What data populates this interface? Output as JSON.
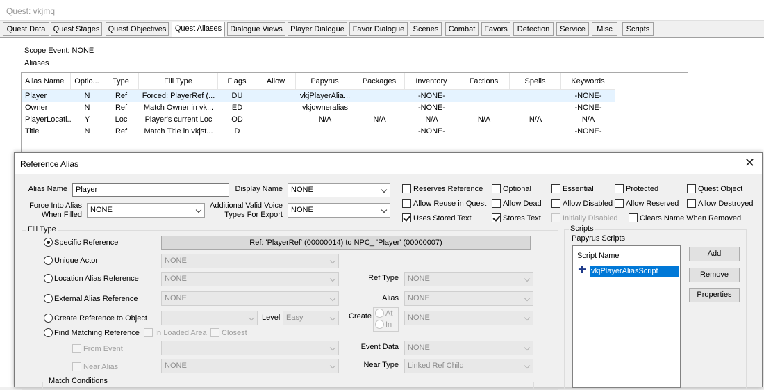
{
  "window": {
    "title": "Quest: vkjmq"
  },
  "tabs": [
    "Quest Data",
    "Quest Stages",
    "Quest Objectives",
    "Quest Aliases",
    "Dialogue Views",
    "Player Dialogue",
    "Favor Dialogue",
    "Scenes",
    "Combat",
    "Favors",
    "Detection",
    "Service",
    "Misc",
    "Scripts"
  ],
  "active_tab": "Quest Aliases",
  "aliases_panel": {
    "scope_event": "Scope Event: NONE",
    "aliases_label": "Aliases",
    "columns": [
      "Alias Name",
      "Optio...",
      "Type",
      "Fill Type",
      "Flags",
      "Allow",
      "Papyrus",
      "Packages",
      "Inventory",
      "Factions",
      "Spells",
      "Keywords"
    ],
    "rows": [
      [
        "Player",
        "N",
        "Ref",
        "Forced: PlayerRef (...",
        "DU",
        "",
        "vkjPlayerAlia...",
        "",
        "-NONE-",
        "",
        "",
        "-NONE-"
      ],
      [
        "Owner",
        "N",
        "Ref",
        "Match Owner in vk...",
        "ED",
        "",
        "vkjowneralias",
        "",
        "-NONE-",
        "",
        "",
        "-NONE-"
      ],
      [
        "PlayerLocati...",
        "Y",
        "Loc",
        "Player's current Loc",
        "OD",
        "",
        "N/A",
        "N/A",
        "N/A",
        "N/A",
        "N/A",
        "N/A"
      ],
      [
        "Title",
        "N",
        "Ref",
        "Match Title in vkjst...",
        "D",
        "",
        "",
        "",
        "-NONE-",
        "",
        "",
        "-NONE-"
      ]
    ]
  },
  "dialog": {
    "title": "Reference Alias",
    "alias_name_label": "Alias Name",
    "alias_name_value": "Player",
    "display_name_label": "Display Name",
    "display_name_value": "NONE",
    "force_into_alias_label_1": "Force Into Alias",
    "force_into_alias_label_2": "When Filled",
    "force_into_alias_value": "NONE",
    "additional_voice_label_1": "Additional Valid Voice",
    "additional_voice_label_2": "Types For Export",
    "additional_voice_value": "NONE",
    "checkboxes": {
      "reserves_reference": "Reserves Reference",
      "optional": "Optional",
      "essential": "Essential",
      "protected": "Protected",
      "quest_object": "Quest Object",
      "allow_reuse": "Allow Reuse in Quest",
      "allow_dead": "Allow Dead",
      "allow_disabled": "Allow Disabled",
      "allow_reserved": "Allow Reserved",
      "allow_destroyed": "Allow Destroyed",
      "uses_stored_text": "Uses Stored Text",
      "stores_text": "Stores Text",
      "initially_disabled": "Initially Disabled",
      "clears_name": "Clears Name When Removed"
    },
    "fill_type": {
      "group_label": "Fill Type",
      "specific_reference": "Specific Reference",
      "specific_reference_value": "Ref: 'PlayerRef' (00000014) to NPC_ 'Player' (00000007)",
      "unique_actor": "Unique Actor",
      "unique_actor_value": "NONE",
      "location_alias_reference": "Location Alias Reference",
      "location_alias_value": "NONE",
      "ref_type_label": "Ref Type",
      "ref_type_value": "NONE",
      "external_alias_reference": "External Alias Reference",
      "external_alias_value": "NONE",
      "alias_label": "Alias",
      "alias_value": "NONE",
      "create_reference": "Create Reference to Object",
      "level_label": "Level",
      "level_value": "Easy",
      "create_label": "Create",
      "create_at": "At",
      "create_in": "In",
      "create_value": "NONE",
      "find_matching_reference": "Find Matching Reference",
      "in_loaded_area": "In Loaded Area",
      "closest": "Closest",
      "from_event": "From Event",
      "event_data_label": "Event Data",
      "event_data_value": "NONE",
      "near_alias": "Near Alias",
      "near_alias_value": "NONE",
      "near_type_label": "Near Type",
      "near_type_value": "Linked Ref Child",
      "match_conditions": "Match Conditions"
    },
    "scripts": {
      "group_label": "Scripts",
      "papyrus_label": "Papyrus Scripts",
      "header": "Script Name",
      "items": [
        "vkjPlayerAliasScript"
      ],
      "add": "Add",
      "remove": "Remove",
      "properties": "Properties"
    },
    "close_glyph": "✕"
  }
}
